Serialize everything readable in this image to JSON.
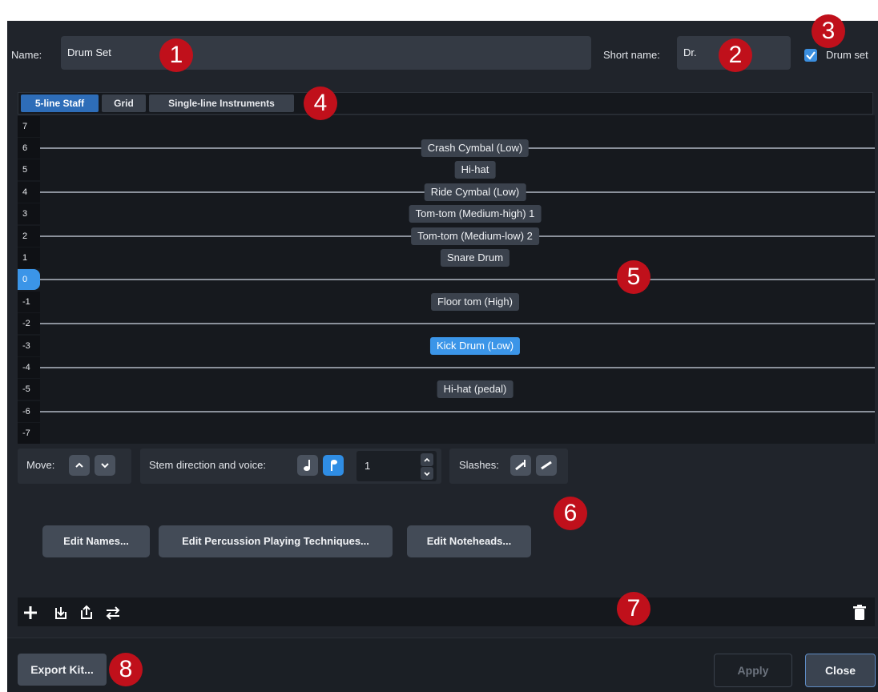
{
  "fields": {
    "name_label": "Name:",
    "name_value": "Drum Set",
    "short_name_label": "Short name:",
    "short_name_value": "Dr.",
    "drum_set_label": "Drum set",
    "drum_set_checked": true
  },
  "tabs": [
    {
      "label": "5-line Staff",
      "active": true
    },
    {
      "label": "Grid",
      "active": false
    },
    {
      "label": "Single-line Instruments",
      "active": false
    }
  ],
  "staff": {
    "positions": [
      "7",
      "6",
      "5",
      "4",
      "3",
      "2",
      "1",
      "0",
      "-1",
      "-2",
      "-3",
      "-4",
      "-5",
      "-6",
      "-7"
    ],
    "selected_position": "0",
    "instruments": [
      {
        "label": "Crash Cymbal (Low)",
        "position": "6"
      },
      {
        "label": "Hi-hat",
        "position": "5"
      },
      {
        "label": "Ride Cymbal (Low)",
        "position": "4"
      },
      {
        "label": "Tom-tom (Medium-high) 1",
        "position": "3"
      },
      {
        "label": "Tom-tom (Medium-low) 2",
        "position": "2"
      },
      {
        "label": "Snare Drum",
        "position": "1"
      },
      {
        "label": "Floor tom (High)",
        "position": "-1"
      },
      {
        "label": "Kick Drum (Low)",
        "position": "-3",
        "selected": true
      },
      {
        "label": "Hi-hat (pedal)",
        "position": "-5"
      }
    ]
  },
  "controls": {
    "move_label": "Move:",
    "stem_label": "Stem direction and voice:",
    "voice_value": "1",
    "slashes_label": "Slashes:"
  },
  "buttons": {
    "edit_names": "Edit Names...",
    "edit_techniques": "Edit Percussion Playing Techniques...",
    "edit_noteheads": "Edit Noteheads..."
  },
  "toolbar_icons": [
    "add-icon",
    "import-icon",
    "export-icon",
    "swap-icon",
    "trash-icon"
  ],
  "footer": {
    "export_kit": "Export Kit...",
    "apply": "Apply",
    "close": "Close"
  },
  "callouts": [
    "1",
    "2",
    "3",
    "4",
    "5",
    "6",
    "7",
    "8"
  ],
  "colors": {
    "accent": "#3b95e8",
    "callout": "#c0101b",
    "background": "#20242b"
  }
}
